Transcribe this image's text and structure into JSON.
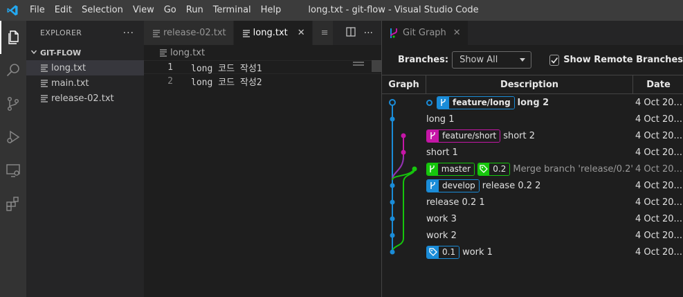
{
  "titlebar": {
    "menu": [
      "File",
      "Edit",
      "Selection",
      "View",
      "Go",
      "Run",
      "Terminal",
      "Help"
    ],
    "title": "long.txt - git-flow - Visual Studio Code"
  },
  "activity": [
    "files-icon",
    "search-icon",
    "source-control-icon",
    "run-debug-icon",
    "remote-explorer-icon",
    "extensions-icon"
  ],
  "sidebar": {
    "header": "EXPLORER",
    "more": "···",
    "folder": "GIT-FLOW",
    "files": [
      "long.txt",
      "main.txt",
      "release-02.txt"
    ]
  },
  "editor": {
    "tabs": [
      {
        "label": "release-02.txt"
      },
      {
        "label": "long.txt",
        "close": "✕"
      },
      {
        "label": "≡"
      }
    ],
    "breadcrumb": "long.txt",
    "lines": [
      {
        "num": "1",
        "text": "long 코드 작성1"
      },
      {
        "num": "2",
        "text": "long 코드 작성2"
      }
    ]
  },
  "gitgraph": {
    "tab": {
      "label": "Git Graph",
      "close": "✕"
    },
    "branches_label": "Branches:",
    "branches_value": "Show All",
    "remote_label": "Show Remote Branches",
    "remote_checked": true,
    "columns": {
      "graph": "Graph",
      "description": "Description",
      "date": "Date"
    },
    "rows": [
      {
        "refs": [
          {
            "name": "feature/long",
            "color": "#1a8cd8",
            "type": "branch"
          }
        ],
        "message": "long 2",
        "date": "4 Oct 20...",
        "head": true
      },
      {
        "refs": [],
        "message": "long 1",
        "date": "4 Oct 20..."
      },
      {
        "refs": [
          {
            "name": "feature/short",
            "color": "#c516a7",
            "type": "branch"
          }
        ],
        "message": "short 2",
        "date": "4 Oct 20..."
      },
      {
        "refs": [],
        "message": "short 1",
        "date": "4 Oct 20..."
      },
      {
        "refs": [
          {
            "name": "master",
            "color": "#16c60c",
            "type": "branch"
          },
          {
            "name": "0.2",
            "color": "#16c60c",
            "type": "tag"
          }
        ],
        "message": "Merge branch 'release/0.2'",
        "date": "4 Oct 20...",
        "dim": true
      },
      {
        "refs": [
          {
            "name": "develop",
            "color": "#1a8cd8",
            "type": "branch"
          }
        ],
        "message": "release 0.2 2",
        "date": "4 Oct 20..."
      },
      {
        "refs": [],
        "message": "release 0.2 1",
        "date": "4 Oct 20..."
      },
      {
        "refs": [],
        "message": "work 3",
        "date": "4 Oct 20..."
      },
      {
        "refs": [],
        "message": "work 2",
        "date": "4 Oct 20..."
      },
      {
        "refs": [
          {
            "name": "0.1",
            "color": "#1a8cd8",
            "type": "tag"
          }
        ],
        "message": "work 1",
        "date": "4 Oct 20..."
      }
    ]
  },
  "colors": {
    "blue": "#1a8cd8",
    "magenta": "#c516a7",
    "green": "#16c60c",
    "purple": "#7b3fb8"
  }
}
